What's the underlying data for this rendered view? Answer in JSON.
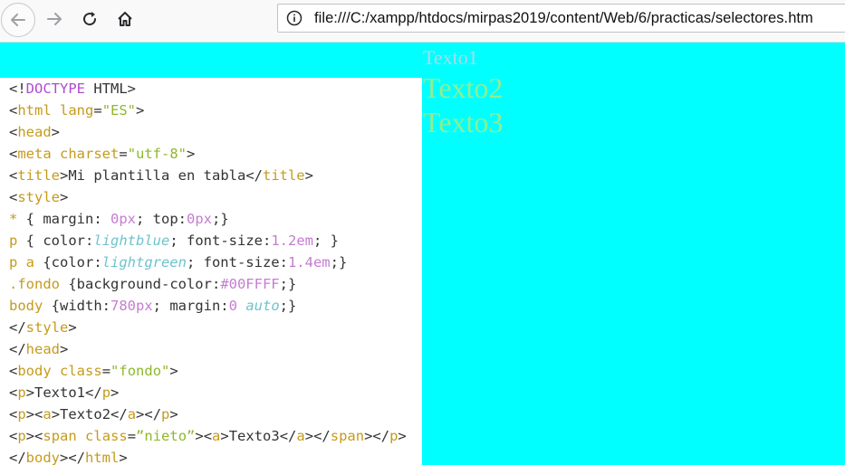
{
  "browser": {
    "url": "file:///C:/xampp/htdocs/mirpas2019/content/Web/6/practicas/selectores.htm"
  },
  "page": {
    "background": "#00FFFF",
    "texts": [
      "Texto1",
      "Texto2",
      "Texto3"
    ],
    "colors": {
      "texto1": "lightblue",
      "texto2": "lightgreen",
      "texto3": "lightgreen"
    }
  },
  "editor": {
    "lines": [
      [
        [
          "pn",
          "<!"
        ],
        [
          "kw",
          "DOCTYPE"
        ],
        [
          "pn",
          " HTML>"
        ]
      ],
      [
        [
          "pn",
          "<"
        ],
        [
          "tg",
          "html"
        ],
        [
          "pn",
          " "
        ],
        [
          "at",
          "lang"
        ],
        [
          "pn",
          "="
        ],
        [
          "sv",
          "\"ES\""
        ],
        [
          "pn",
          ">"
        ]
      ],
      [
        [
          "pn",
          "<"
        ],
        [
          "tg",
          "head"
        ],
        [
          "pn",
          ">"
        ]
      ],
      [
        [
          "pn",
          "<"
        ],
        [
          "tg",
          "meta"
        ],
        [
          "pn",
          " "
        ],
        [
          "at",
          "charset"
        ],
        [
          "pn",
          "="
        ],
        [
          "sv",
          "\"utf-8\""
        ],
        [
          "pn",
          ">"
        ]
      ],
      [
        [
          "pn",
          "<"
        ],
        [
          "tg",
          "title"
        ],
        [
          "pn",
          ">Mi plantilla en tabla</"
        ],
        [
          "tg",
          "title"
        ],
        [
          "pn",
          ">"
        ]
      ],
      [
        [
          "pn",
          "<"
        ],
        [
          "tg",
          "style"
        ],
        [
          "pn",
          ">"
        ]
      ],
      [
        [
          "sel",
          "*"
        ],
        [
          "pn",
          " { margin: "
        ],
        [
          "vl",
          "0px"
        ],
        [
          "pn",
          "; top:"
        ],
        [
          "vl",
          "0px"
        ],
        [
          "pn",
          ";}"
        ]
      ],
      [
        [
          "sel",
          "p"
        ],
        [
          "pn",
          " { color:"
        ],
        [
          "it",
          "lightblue"
        ],
        [
          "pn",
          "; font-size:"
        ],
        [
          "vl",
          "1.2em"
        ],
        [
          "pn",
          "; }"
        ]
      ],
      [
        [
          "sel",
          "p a"
        ],
        [
          "pn",
          " {color:"
        ],
        [
          "it",
          "lightgreen"
        ],
        [
          "pn",
          "; font-size:"
        ],
        [
          "vl",
          "1.4em"
        ],
        [
          "pn",
          ";}"
        ]
      ],
      [
        [
          "sel",
          ".fondo"
        ],
        [
          "pn",
          " {background-color:"
        ],
        [
          "vl",
          "#00FFFF"
        ],
        [
          "pn",
          ";}"
        ]
      ],
      [
        [
          "sel",
          "body"
        ],
        [
          "pn",
          " {width:"
        ],
        [
          "vl",
          "780px"
        ],
        [
          "pn",
          "; margin:"
        ],
        [
          "vl",
          "0 "
        ],
        [
          "it",
          "auto"
        ],
        [
          "pn",
          ";}"
        ]
      ],
      [
        [
          "pn",
          "</"
        ],
        [
          "tg",
          "style"
        ],
        [
          "pn",
          ">"
        ]
      ],
      [
        [
          "pn",
          "</"
        ],
        [
          "tg",
          "head"
        ],
        [
          "pn",
          ">"
        ]
      ],
      [
        [
          "pn",
          "<"
        ],
        [
          "tg",
          "body"
        ],
        [
          "pn",
          " "
        ],
        [
          "at",
          "class"
        ],
        [
          "pn",
          "="
        ],
        [
          "sv",
          "\"fondo\""
        ],
        [
          "pn",
          ">"
        ]
      ],
      [
        [
          "pn",
          "<"
        ],
        [
          "tg",
          "p"
        ],
        [
          "pn",
          ">Texto1</"
        ],
        [
          "tg",
          "p"
        ],
        [
          "pn",
          ">"
        ]
      ],
      [
        [
          "pn",
          "<"
        ],
        [
          "tg",
          "p"
        ],
        [
          "pn",
          "><"
        ],
        [
          "tg",
          "a"
        ],
        [
          "pn",
          ">Texto2</"
        ],
        [
          "tg",
          "a"
        ],
        [
          "pn",
          "></"
        ],
        [
          "tg",
          "p"
        ],
        [
          "pn",
          ">"
        ]
      ],
      [
        [
          "pn",
          "<"
        ],
        [
          "tg",
          "p"
        ],
        [
          "pn",
          "><"
        ],
        [
          "tg",
          "span"
        ],
        [
          "pn",
          " "
        ],
        [
          "at",
          "class"
        ],
        [
          "pn",
          "="
        ],
        [
          "sv",
          "”nieto”"
        ],
        [
          "pn",
          "><"
        ],
        [
          "tg",
          "a"
        ],
        [
          "pn",
          ">Texto3</"
        ],
        [
          "tg",
          "a"
        ],
        [
          "pn",
          "></"
        ],
        [
          "tg",
          "span"
        ],
        [
          "pn",
          "></"
        ],
        [
          "tg",
          "p"
        ],
        [
          "pn",
          ">"
        ]
      ],
      [
        [
          "pn",
          "</"
        ],
        [
          "tg",
          "body"
        ],
        [
          "pn",
          "></"
        ],
        [
          "tg",
          "html"
        ],
        [
          "pn",
          ">"
        ]
      ]
    ]
  }
}
